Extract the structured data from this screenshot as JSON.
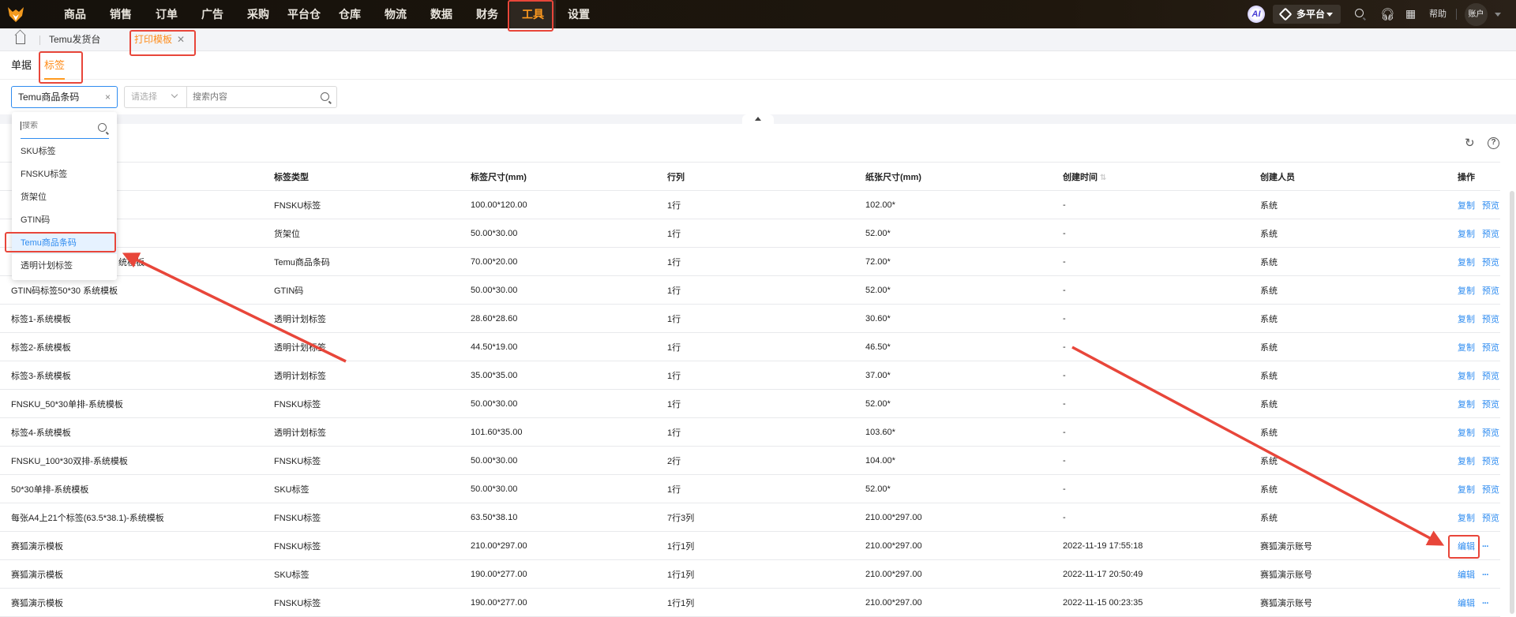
{
  "topbar": {
    "nav": [
      "商品",
      "销售",
      "订单",
      "广告",
      "采购",
      "平台仓",
      "仓库",
      "物流",
      "数据",
      "财务",
      "工具",
      "设置"
    ],
    "active_nav": "工具",
    "ai_label": "AI",
    "platform_label": "多平台",
    "help_label": "帮助",
    "account_label": "账户",
    "accent": "#ff9a1f"
  },
  "tabs": {
    "home_icon": "home-icon",
    "items": [
      "Temu发货台",
      "打印模板"
    ],
    "active": "打印模板",
    "close": "✕"
  },
  "subtabs": {
    "items": [
      "单据",
      "标签"
    ],
    "active": "标签"
  },
  "filter": {
    "type_value": "Temu商品条码",
    "clear": "×",
    "field_placeholder": "请选择",
    "search_placeholder": "搜索内容"
  },
  "dropdown": {
    "search_placeholder": "搜索",
    "options": [
      "SKU标签",
      "FNSKU标签",
      "货架位",
      "GTIN码",
      "Temu商品条码",
      "透明计划标签"
    ],
    "selected": "Temu商品条码"
  },
  "table": {
    "columns": [
      "",
      "标签类型",
      "标签尺寸(mm)",
      "行列",
      "纸张尺寸(mm)",
      "创建时间",
      "创建人员",
      "操作"
    ],
    "rows": [
      {
        "name": "",
        "type": "FNSKU标签",
        "size": "100.00*120.00",
        "rc": "1行",
        "paper": "102.00*",
        "time": "-",
        "creator": "系统",
        "ops": [
          "复制",
          "预览"
        ]
      },
      {
        "name": "",
        "type": "货架位",
        "size": "50.00*30.00",
        "rc": "1行",
        "paper": "52.00*",
        "time": "-",
        "creator": "系统",
        "ops": [
          "复制",
          "预览"
        ]
      },
      {
        "name": "统模板",
        "type": "Temu商品条码",
        "size": "70.00*20.00",
        "rc": "1行",
        "paper": "72.00*",
        "time": "-",
        "creator": "系统",
        "ops": [
          "复制",
          "预览"
        ]
      },
      {
        "name": "GTIN码标签50*30 系统模板",
        "type": "GTIN码",
        "size": "50.00*30.00",
        "rc": "1行",
        "paper": "52.00*",
        "time": "-",
        "creator": "系统",
        "ops": [
          "复制",
          "预览"
        ]
      },
      {
        "name": "标签1-系统模板",
        "type": "透明计划标签",
        "size": "28.60*28.60",
        "rc": "1行",
        "paper": "30.60*",
        "time": "-",
        "creator": "系统",
        "ops": [
          "复制",
          "预览"
        ]
      },
      {
        "name": "标签2-系统模板",
        "type": "透明计划标签",
        "size": "44.50*19.00",
        "rc": "1行",
        "paper": "46.50*",
        "time": "-",
        "creator": "系统",
        "ops": [
          "复制",
          "预览"
        ]
      },
      {
        "name": "标签3-系统模板",
        "type": "透明计划标签",
        "size": "35.00*35.00",
        "rc": "1行",
        "paper": "37.00*",
        "time": "-",
        "creator": "系统",
        "ops": [
          "复制",
          "预览"
        ]
      },
      {
        "name": "FNSKU_50*30单排-系统模板",
        "type": "FNSKU标签",
        "size": "50.00*30.00",
        "rc": "1行",
        "paper": "52.00*",
        "time": "-",
        "creator": "系统",
        "ops": [
          "复制",
          "预览"
        ]
      },
      {
        "name": "标签4-系统模板",
        "type": "透明计划标签",
        "size": "101.60*35.00",
        "rc": "1行",
        "paper": "103.60*",
        "time": "-",
        "creator": "系统",
        "ops": [
          "复制",
          "预览"
        ]
      },
      {
        "name": "FNSKU_100*30双排-系统模板",
        "type": "FNSKU标签",
        "size": "50.00*30.00",
        "rc": "2行",
        "paper": "104.00*",
        "time": "-",
        "creator": "系统",
        "ops": [
          "复制",
          "预览"
        ]
      },
      {
        "name": "50*30单排-系统模板",
        "type": "SKU标签",
        "size": "50.00*30.00",
        "rc": "1行",
        "paper": "52.00*",
        "time": "-",
        "creator": "系统",
        "ops": [
          "复制",
          "预览"
        ]
      },
      {
        "name": "每张A4上21个标签(63.5*38.1)-系统模板",
        "type": "FNSKU标签",
        "size": "63.50*38.10",
        "rc": "7行3列",
        "paper": "210.00*297.00",
        "time": "-",
        "creator": "系统",
        "ops": [
          "复制",
          "预览"
        ]
      },
      {
        "name": "赛狐演示模板",
        "type": "FNSKU标签",
        "size": "210.00*297.00",
        "rc": "1行1列",
        "paper": "210.00*297.00",
        "time": "2022-11-19 17:55:18",
        "creator": "赛狐演示账号",
        "ops": [
          "编辑",
          "···"
        ]
      },
      {
        "name": "赛狐演示模板",
        "type": "SKU标签",
        "size": "190.00*277.00",
        "rc": "1行1列",
        "paper": "210.00*297.00",
        "time": "2022-11-17 20:50:49",
        "creator": "赛狐演示账号",
        "ops": [
          "编辑",
          "···"
        ]
      },
      {
        "name": "赛狐演示模板",
        "type": "FNSKU标签",
        "size": "190.00*277.00",
        "rc": "1行1列",
        "paper": "210.00*297.00",
        "time": "2022-11-15 00:23:35",
        "creator": "赛狐演示账号",
        "ops": [
          "编辑",
          "···"
        ]
      }
    ]
  },
  "colors": {
    "link": "#2f8cf0",
    "annotation": "#e8463a"
  }
}
